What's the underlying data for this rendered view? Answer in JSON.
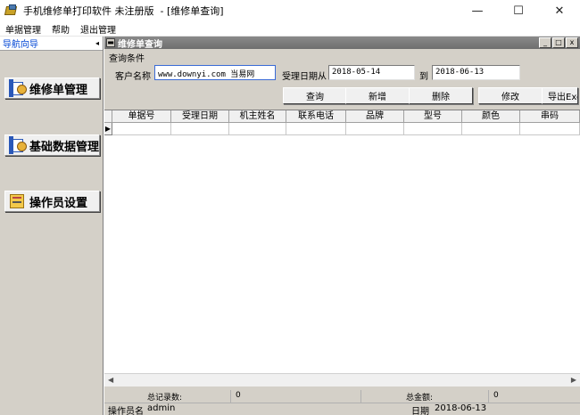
{
  "window": {
    "title": "手机维修单打印软件 未注册版  - [维修单查询]",
    "controls": {
      "minimize": "—",
      "maximize": "☐",
      "close": "✕"
    }
  },
  "menu": [
    "单据管理",
    "帮助",
    "退出管理"
  ],
  "nav": {
    "header": "导航向导",
    "collapse_glyph": "◂",
    "buttons": [
      {
        "label": "维修单管理",
        "icon": "repair-doc-icon"
      },
      {
        "label": "基础数据管理",
        "icon": "database-icon"
      },
      {
        "label": "操作员设置",
        "icon": "operator-icon"
      }
    ]
  },
  "child": {
    "title": "维修单查询",
    "sys_glyph": "▬",
    "controls": {
      "minimize": "_",
      "maximize": "□",
      "close": "x"
    }
  },
  "query": {
    "section_label": "查询条件",
    "customer_label": "客户名称",
    "customer_value": "www.downyi.com  当易网",
    "date_from_label": "受理日期从",
    "date_from_value": "2018-05-14",
    "date_to_label": "到",
    "date_to_value": "2018-06-13"
  },
  "actions": [
    "查询",
    "新增",
    "删除",
    "修改",
    "导出Excel"
  ],
  "grid": {
    "row_indicator": "▶",
    "columns": [
      "单据号",
      "受理日期",
      "机主姓名",
      "联系电话",
      "品牌",
      "型号",
      "颜色",
      "串码"
    ]
  },
  "summary": {
    "count_label": "总记录数:",
    "count_value": "0",
    "amount_label": "总金额:",
    "amount_value": "0"
  },
  "status": {
    "operator_label": "操作员名",
    "operator_value": "admin",
    "date_label": "日期",
    "date_value": "2018-06-13"
  }
}
